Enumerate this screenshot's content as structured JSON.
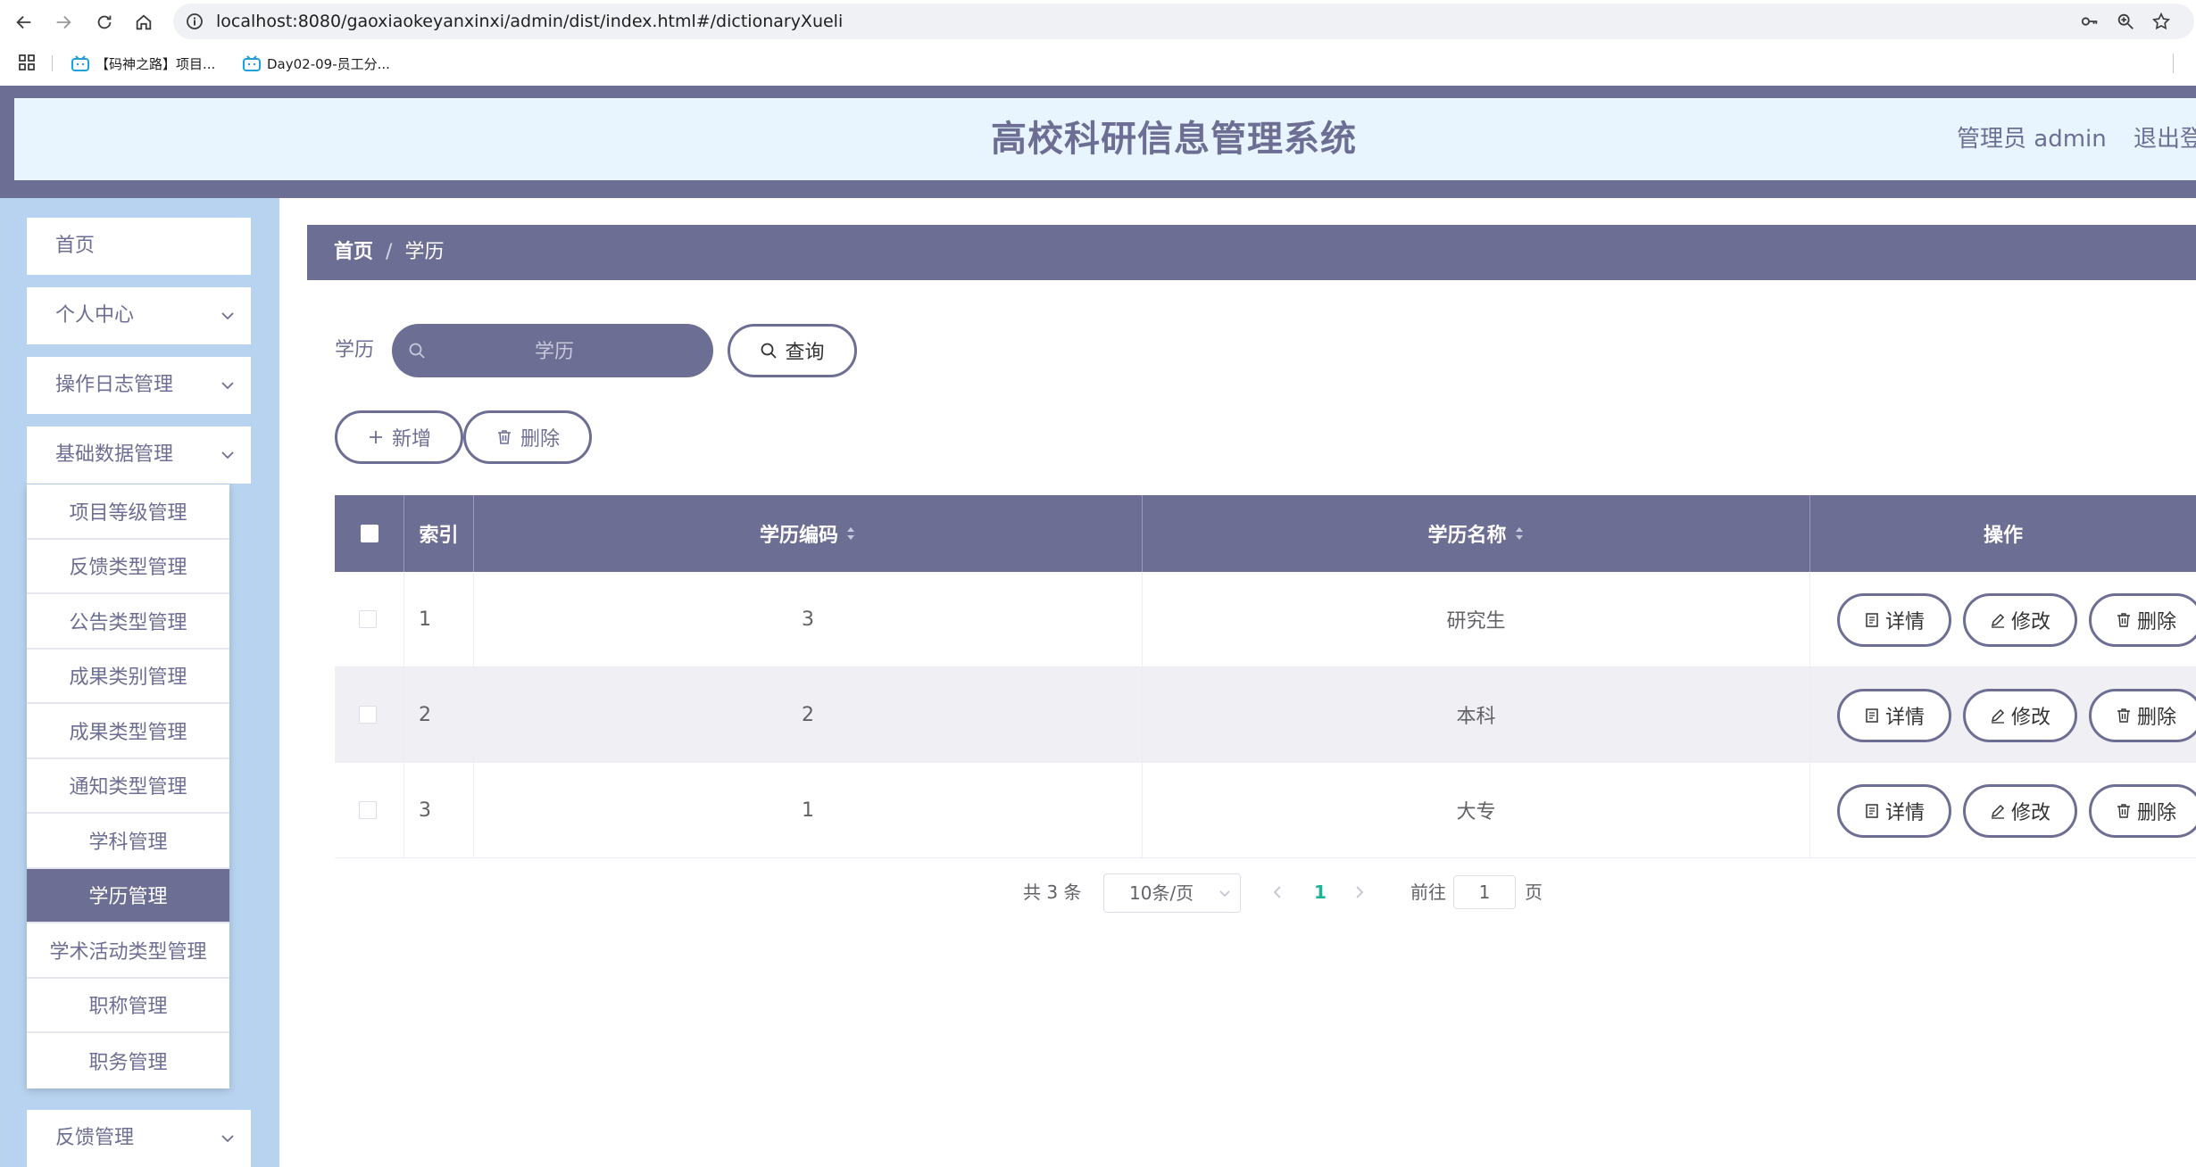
{
  "browser": {
    "url": "localhost:8080/gaoxiaokeyanxinxi/admin/dist/index.html#/dictionaryXueli",
    "bookmarks": [
      "【码神之路】项目...",
      "Day02-09-员工分..."
    ]
  },
  "header": {
    "title": "高校科研信息管理系统",
    "user": "管理员 admin",
    "logout": "退出登录"
  },
  "sidebar": {
    "items": [
      {
        "label": "首页"
      },
      {
        "label": "个人中心"
      },
      {
        "label": "操作日志管理"
      },
      {
        "label": "基础数据管理"
      },
      {
        "label": "反馈管理"
      }
    ],
    "submenu": [
      "项目等级管理",
      "反馈类型管理",
      "公告类型管理",
      "成果类别管理",
      "成果类型管理",
      "通知类型管理",
      "学科管理",
      "学历管理",
      "学术活动类型管理",
      "职称管理",
      "职务管理"
    ],
    "active_submenu": "学历管理"
  },
  "breadcrumb": {
    "home": "首页",
    "sep": "/",
    "current": "学历"
  },
  "search": {
    "label": "学历",
    "placeholder": "学历",
    "query_button": "查询"
  },
  "actions": {
    "add": "新增",
    "delete": "删除"
  },
  "table": {
    "headers": {
      "index": "索引",
      "code": "学历编码",
      "name": "学历名称",
      "ops": "操作"
    },
    "rows": [
      {
        "index": "1",
        "code": "3",
        "name": "研究生"
      },
      {
        "index": "2",
        "code": "2",
        "name": "本科"
      },
      {
        "index": "3",
        "code": "1",
        "name": "大专"
      }
    ],
    "row_buttons": {
      "detail": "详情",
      "edit": "修改",
      "delete": "删除"
    }
  },
  "pagination": {
    "total": "共 3 条",
    "page_size": "10条/页",
    "current_page": "1",
    "goto_label": "前往",
    "goto_value": "1",
    "page_unit": "页"
  },
  "colors": {
    "primary": "#6d6e94",
    "header_bg": "#e8f5ff",
    "sidebar_bg": "#b8d3ef",
    "page_active": "#1ab394"
  }
}
